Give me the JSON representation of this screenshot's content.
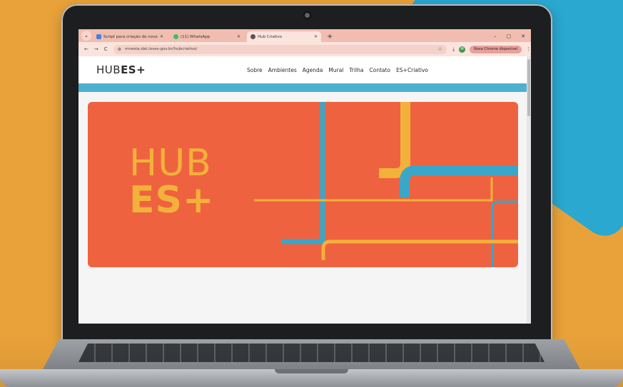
{
  "browser": {
    "tabs": [
      {
        "label": "Script para criação do novo site",
        "favicon_color": "#4A7FE0",
        "active": false
      },
      {
        "label": "(11) WhatsApp",
        "favicon_color": "#3FBF5A",
        "active": false
      },
      {
        "label": "Hub Criativo",
        "favicon_color": "#555555",
        "active": true
      }
    ],
    "new_tab": "+",
    "window_controls": [
      "–",
      "▢",
      "✕"
    ],
    "nav": {
      "back": "←",
      "forward": "→",
      "reload": "C"
    },
    "address": "mnesta.dat.ioves-gov.br/hubcriativo/",
    "site_icon": "⚙",
    "star": "☆",
    "download": "⤓",
    "profile_letter": "M",
    "update_button": "Nova Chrome disponível",
    "menu": "⋮"
  },
  "site": {
    "logo_thin": "HUB",
    "logo_bold": "ES+",
    "nav": [
      "Sobre",
      "Ambientes",
      "Agenda",
      "Mural",
      "Trilha",
      "Contato",
      "ES+Criativo"
    ]
  },
  "hero": {
    "line1": "HUB",
    "line2": "ES+",
    "colors": {
      "background": "#EF6240",
      "yellow": "#F2B13A",
      "blue": "#3AA7C9"
    }
  },
  "scene": {
    "background": "#E9A23A",
    "accent": "#2AA8D0"
  }
}
